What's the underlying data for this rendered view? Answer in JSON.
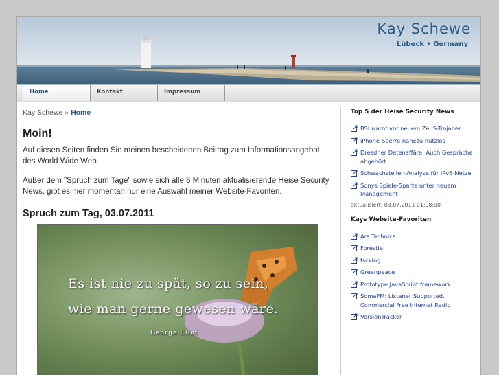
{
  "header": {
    "site_title": "Kay Schewe",
    "site_subtitle": "Lübeck • Germany"
  },
  "nav": {
    "tabs": [
      {
        "label": "Home",
        "active": true
      },
      {
        "label": "Kontakt",
        "active": false
      },
      {
        "label": "Impressum",
        "active": false
      }
    ]
  },
  "breadcrumb": {
    "root": "Kay Schewe",
    "separator": "»",
    "current": "Home"
  },
  "main": {
    "heading": "Moin!",
    "paragraph1": "Auf diesen Seiten finden Sie meinen bescheidenen Beitrag zum Informationsangebot des World Wide Web.",
    "paragraph2": "Außer dem \"Spruch zum Tage\" sowie sich alle 5 Minuten aktualisierende Heise Security News, gibt es hier momentan nur eine Auswahl meiner Website-Favoriten.",
    "quote_heading": "Spruch zum Tag, 03.07.2011",
    "quote_line1": "Es ist nie zu spät, so zu sein,",
    "quote_line2": "wie man gerne gewesen wäre.",
    "quote_author": "George Eliot"
  },
  "sidebar": {
    "security_title": "Top 5 der Heise Security News",
    "security_items": [
      "BSI warnt vor neuem ZeuS-Trojaner",
      "iPhone-Sperre nahezu nutzlos",
      "Dresdner Datenaffäre: Auch Gespräche abgehört",
      "Schwachstellen-Analyse für IPv6-Netze",
      "Sonys Spiele-Sparte unter neuem Management"
    ],
    "updated": "aktualisiert: 03.07.2011 01:08:00",
    "favorites_title": "Kays Website-Favoriten",
    "favorites_items": [
      "Ars Technica",
      "Forestle",
      "fsckIog",
      "Greenpeace",
      "Prototype JavaScript framework",
      "SomaFM: Listener Supported. Commercial Free Internet Radio",
      "VersionTracker"
    ]
  },
  "colors": {
    "accent": "#2e5c86",
    "link": "#1f3fa6",
    "page_bg": "#c9c9c9"
  }
}
